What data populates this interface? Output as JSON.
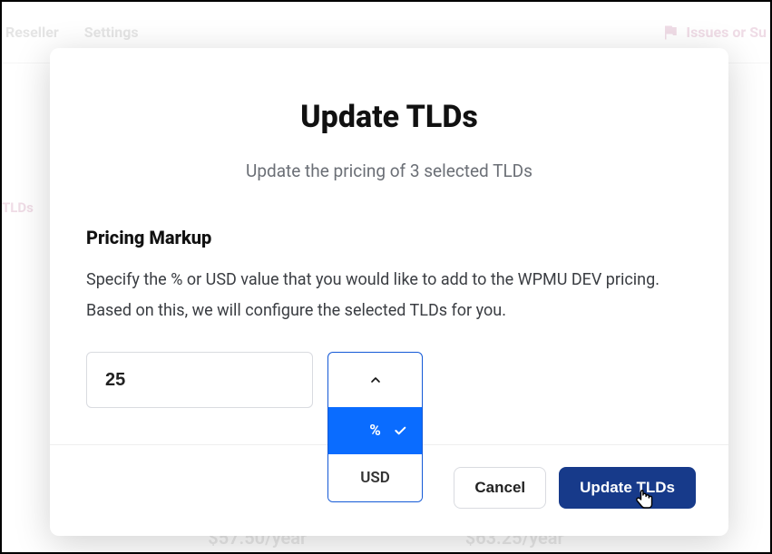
{
  "background": {
    "nav": {
      "reseller": "Reseller",
      "settings": "Settings",
      "issues": "Issues or Su"
    },
    "leftTab": "TLDs",
    "price1": "$57.50/year",
    "price2": "$63.25/year"
  },
  "modal": {
    "title": "Update TLDs",
    "subtitle": "Update the pricing of 3 selected TLDs",
    "sectionLabel": "Pricing Markup",
    "sectionDesc": "Specify the % or USD value that you would like to add to the WPMU DEV pricing. Based on this, we will configure the selected TLDs for you.",
    "markupValue": "25",
    "unitOptions": {
      "percent": "%",
      "usd": "USD"
    },
    "buttons": {
      "cancel": "Cancel",
      "confirm": "Update TLDs"
    }
  }
}
